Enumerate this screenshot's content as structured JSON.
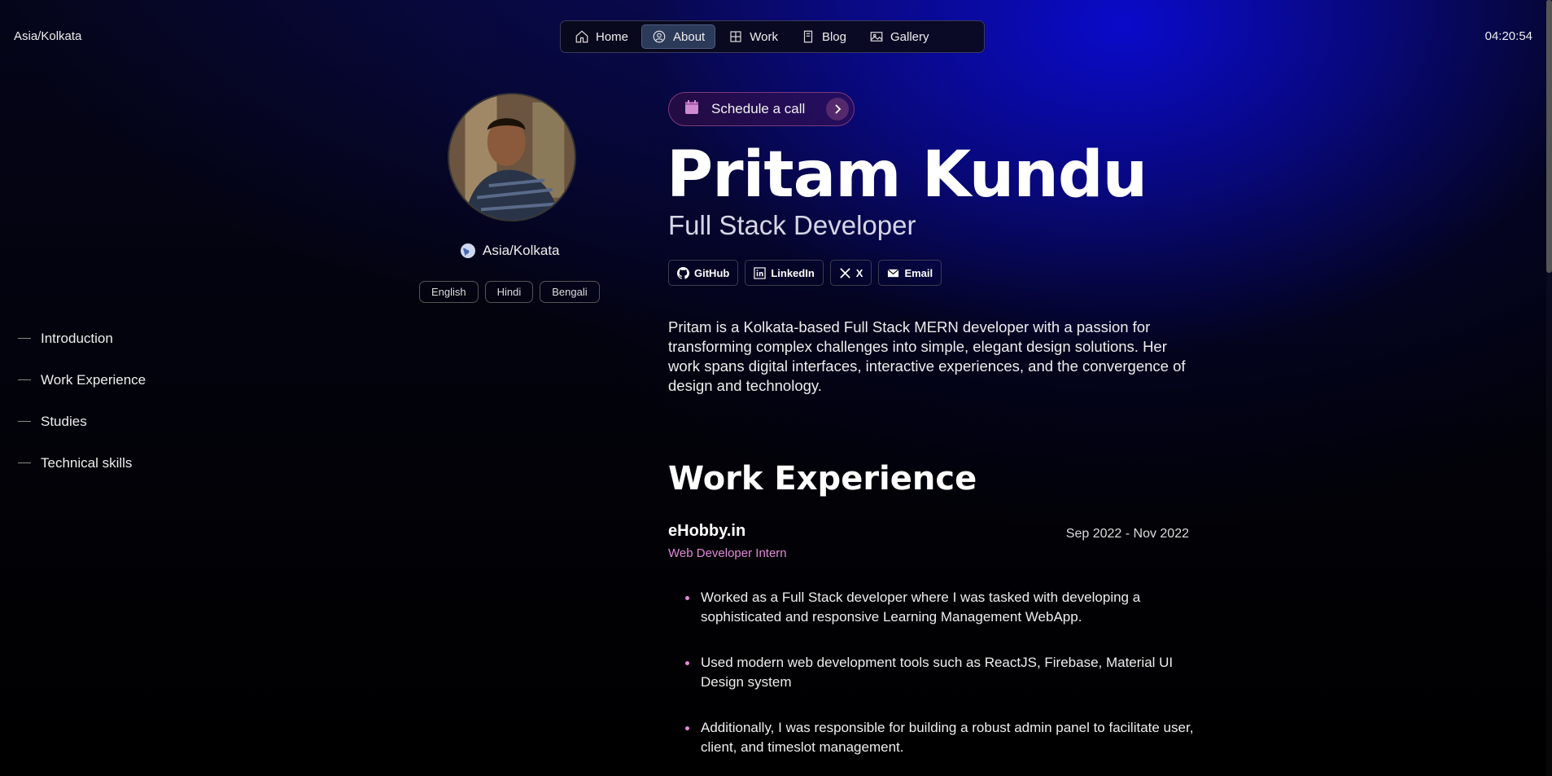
{
  "topbar": {
    "timezone_left": "Asia/Kolkata",
    "clock": "04:20:54"
  },
  "nav": {
    "items": [
      {
        "label": "Home",
        "icon": "home-icon"
      },
      {
        "label": "About",
        "icon": "user-circle-icon",
        "active": true
      },
      {
        "label": "Work",
        "icon": "grid-icon"
      },
      {
        "label": "Blog",
        "icon": "book-icon"
      },
      {
        "label": "Gallery",
        "icon": "image-icon"
      }
    ]
  },
  "profile": {
    "location": "Asia/Kolkata",
    "languages": [
      "English",
      "Hindi",
      "Bengali"
    ]
  },
  "sidebar": {
    "items": [
      "Introduction",
      "Work Experience",
      "Studies",
      "Technical skills"
    ]
  },
  "hero": {
    "schedule_label": "Schedule a call",
    "name": "Pritam Kundu",
    "role": "Full Stack Developer",
    "socials": [
      {
        "label": "GitHub",
        "icon": "github-icon"
      },
      {
        "label": "LinkedIn",
        "icon": "linkedin-icon"
      },
      {
        "label": "X",
        "icon": "x-icon"
      },
      {
        "label": "Email",
        "icon": "email-icon"
      }
    ],
    "intro": "Pritam is a Kolkata-based Full Stack MERN developer with a passion for transforming complex challenges into simple, elegant design solutions. Her work spans digital interfaces, interactive experiences, and the convergence of design and technology."
  },
  "work": {
    "title": "Work Experience",
    "company": "eHobby.in",
    "role": "Web Developer Intern",
    "dates": "Sep 2022 - Nov 2022",
    "bullets": [
      "Worked as a Full Stack developer where I was tasked with developing a sophisticated and responsive Learning Management WebApp.",
      "Used modern web development tools such as ReactJS, Firebase, Material UI Design system",
      "Additionally, I was responsible for building a robust admin panel to facilitate user, client, and timeslot management."
    ]
  },
  "colors": {
    "accent_pink": "#e48ad8",
    "nav_active": "#2c3a5a",
    "bg_blue": "#0a0ad2"
  }
}
